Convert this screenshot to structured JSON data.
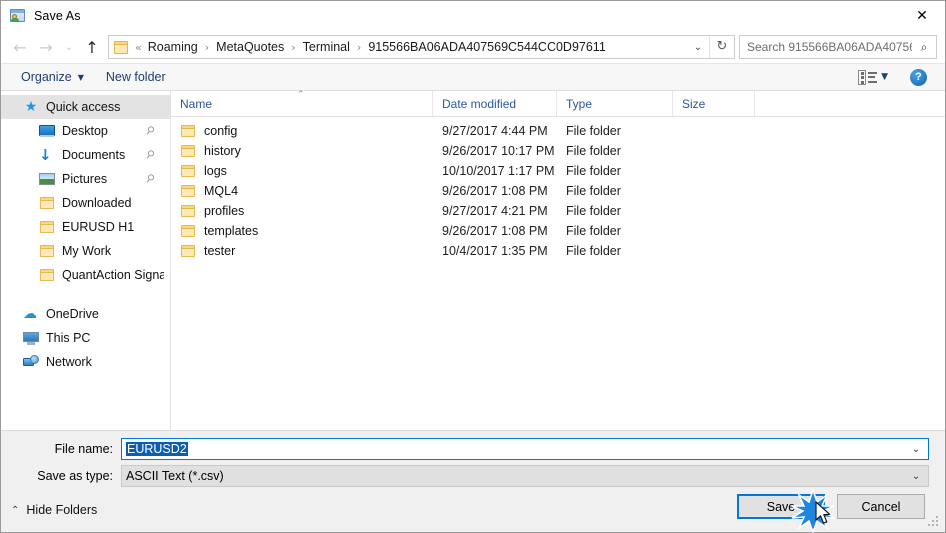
{
  "window": {
    "title": "Save As",
    "icon": "save-as-icon",
    "close_label": "✕"
  },
  "nav": {
    "back_icon": "arrow-left-icon",
    "back_glyph": "←",
    "forward_icon": "arrow-right-icon",
    "forward_glyph": "→",
    "recent_icon": "chevron-down-icon",
    "recent_glyph": "⌄",
    "up_icon": "arrow-up-icon",
    "up_glyph": "↑",
    "address_dropdown_glyph": "⌄",
    "refresh_glyph": "↻",
    "breadcrumb_prefix": "«",
    "breadcrumbs": [
      "Roaming",
      "MetaQuotes",
      "Terminal",
      "915566BA06ADA407569C544CC0D97611"
    ],
    "breadcrumb_separator": "›"
  },
  "search": {
    "placeholder": "Search 915566BA06ADA40756...",
    "icon": "search-icon",
    "icon_glyph": "⌕"
  },
  "toolbar": {
    "organize_label": "Organize",
    "organize_caret": "▼",
    "new_folder_label": "New folder",
    "view_icon": "view-layout-icon",
    "view_caret": "▼",
    "help_icon": "help-icon",
    "help_glyph": "?"
  },
  "sidebar": {
    "items": [
      {
        "label": "Quick access",
        "icon": "star-pin-icon",
        "type": "quickaccess",
        "indent": 0,
        "selected": true,
        "pinned": false
      },
      {
        "label": "Desktop",
        "icon": "desktop-icon",
        "type": "desktop",
        "indent": 1,
        "selected": false,
        "pinned": true
      },
      {
        "label": "Documents",
        "icon": "documents-download-icon",
        "type": "documents",
        "indent": 1,
        "selected": false,
        "pinned": true
      },
      {
        "label": "Pictures",
        "icon": "pictures-icon",
        "type": "pictures",
        "indent": 1,
        "selected": false,
        "pinned": true
      },
      {
        "label": "Downloaded",
        "icon": "folder-icon",
        "type": "folder",
        "indent": 1,
        "selected": false,
        "pinned": false
      },
      {
        "label": "EURUSD H1",
        "icon": "folder-icon",
        "type": "folder",
        "indent": 1,
        "selected": false,
        "pinned": false
      },
      {
        "label": "My Work",
        "icon": "folder-icon",
        "type": "folder",
        "indent": 1,
        "selected": false,
        "pinned": false
      },
      {
        "label": "QuantAction Signal",
        "icon": "folder-icon",
        "type": "folder",
        "indent": 1,
        "selected": false,
        "pinned": false
      }
    ],
    "groups": [
      {
        "label": "OneDrive",
        "icon": "onedrive-cloud-icon",
        "type": "onedrive"
      },
      {
        "label": "This PC",
        "icon": "this-pc-icon",
        "type": "thispc"
      },
      {
        "label": "Network",
        "icon": "network-icon",
        "type": "network"
      }
    ],
    "pin_glyph": "📌"
  },
  "filelist": {
    "columns": [
      "Name",
      "Date modified",
      "Type",
      "Size"
    ],
    "sort_caret": "⌃",
    "rows": [
      {
        "name": "config",
        "date": "9/27/2017 4:44 PM",
        "type": "File folder",
        "size": ""
      },
      {
        "name": "history",
        "date": "9/26/2017 10:17 PM",
        "type": "File folder",
        "size": ""
      },
      {
        "name": "logs",
        "date": "10/10/2017 1:17 PM",
        "type": "File folder",
        "size": ""
      },
      {
        "name": "MQL4",
        "date": "9/26/2017 1:08 PM",
        "type": "File folder",
        "size": ""
      },
      {
        "name": "profiles",
        "date": "9/27/2017 4:21 PM",
        "type": "File folder",
        "size": ""
      },
      {
        "name": "templates",
        "date": "9/26/2017 1:08 PM",
        "type": "File folder",
        "size": ""
      },
      {
        "name": "tester",
        "date": "10/4/2017 1:35 PM",
        "type": "File folder",
        "size": ""
      }
    ]
  },
  "form": {
    "filename_label": "File name:",
    "filename_value": "EURUSD2",
    "filetype_label": "Save as type:",
    "filetype_value": "ASCII Text (*.csv)",
    "dropdown_glyph": "⌄"
  },
  "footer": {
    "hide_folders_label": "Hide Folders",
    "hide_folders_caret": "⌃",
    "save_label": "Save",
    "cancel_label": "Cancel"
  },
  "colors": {
    "accent": "#0078d7",
    "selection": "#0a5fb4",
    "header_text": "#2b5797",
    "toolbar_link": "#1c3f6e"
  }
}
